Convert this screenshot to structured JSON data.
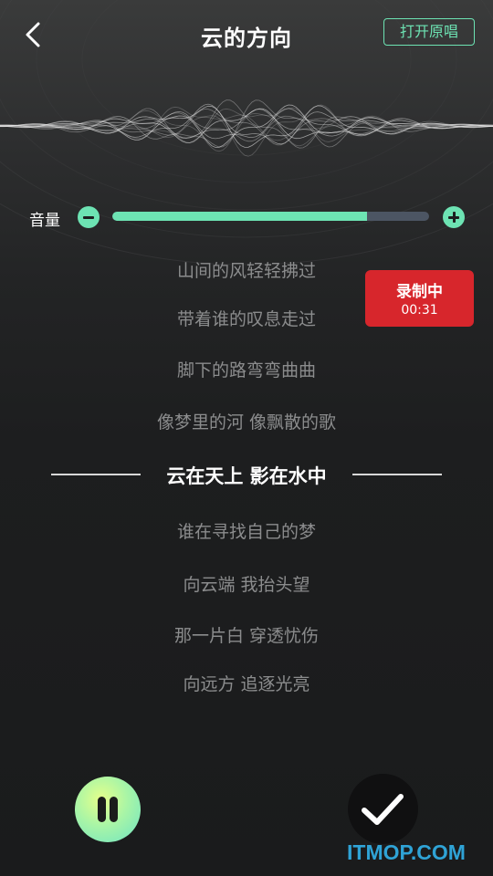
{
  "header": {
    "title": "云的方向",
    "open_original_label": "打开原唱"
  },
  "volume": {
    "label": "音量",
    "level_fraction": 0.804
  },
  "recording": {
    "status": "录制中",
    "elapsed": "00:31"
  },
  "lyrics": [
    {
      "text": "山间的风轻轻拂过",
      "current": false
    },
    {
      "text": "带着谁的叹息走过",
      "current": false
    },
    {
      "text": "脚下的路弯弯曲曲",
      "current": false
    },
    {
      "text": "像梦里的河 像飘散的歌",
      "current": false
    },
    {
      "text": "云在天上 影在水中",
      "current": true
    },
    {
      "text": "谁在寻找自己的梦",
      "current": false
    },
    {
      "text": "向云端 我抬头望",
      "current": false
    },
    {
      "text": "那一片白 穿透忧伤",
      "current": false
    },
    {
      "text": "向远方 追逐光亮",
      "current": false
    }
  ],
  "controls": {
    "pause_icon": "pause-icon",
    "done_icon": "checkmark-icon"
  },
  "watermark": "ITMOP.COM",
  "colors": {
    "accent": "#6de3b3",
    "recording": "#d7262c",
    "watermark": "#2fa3d6"
  }
}
